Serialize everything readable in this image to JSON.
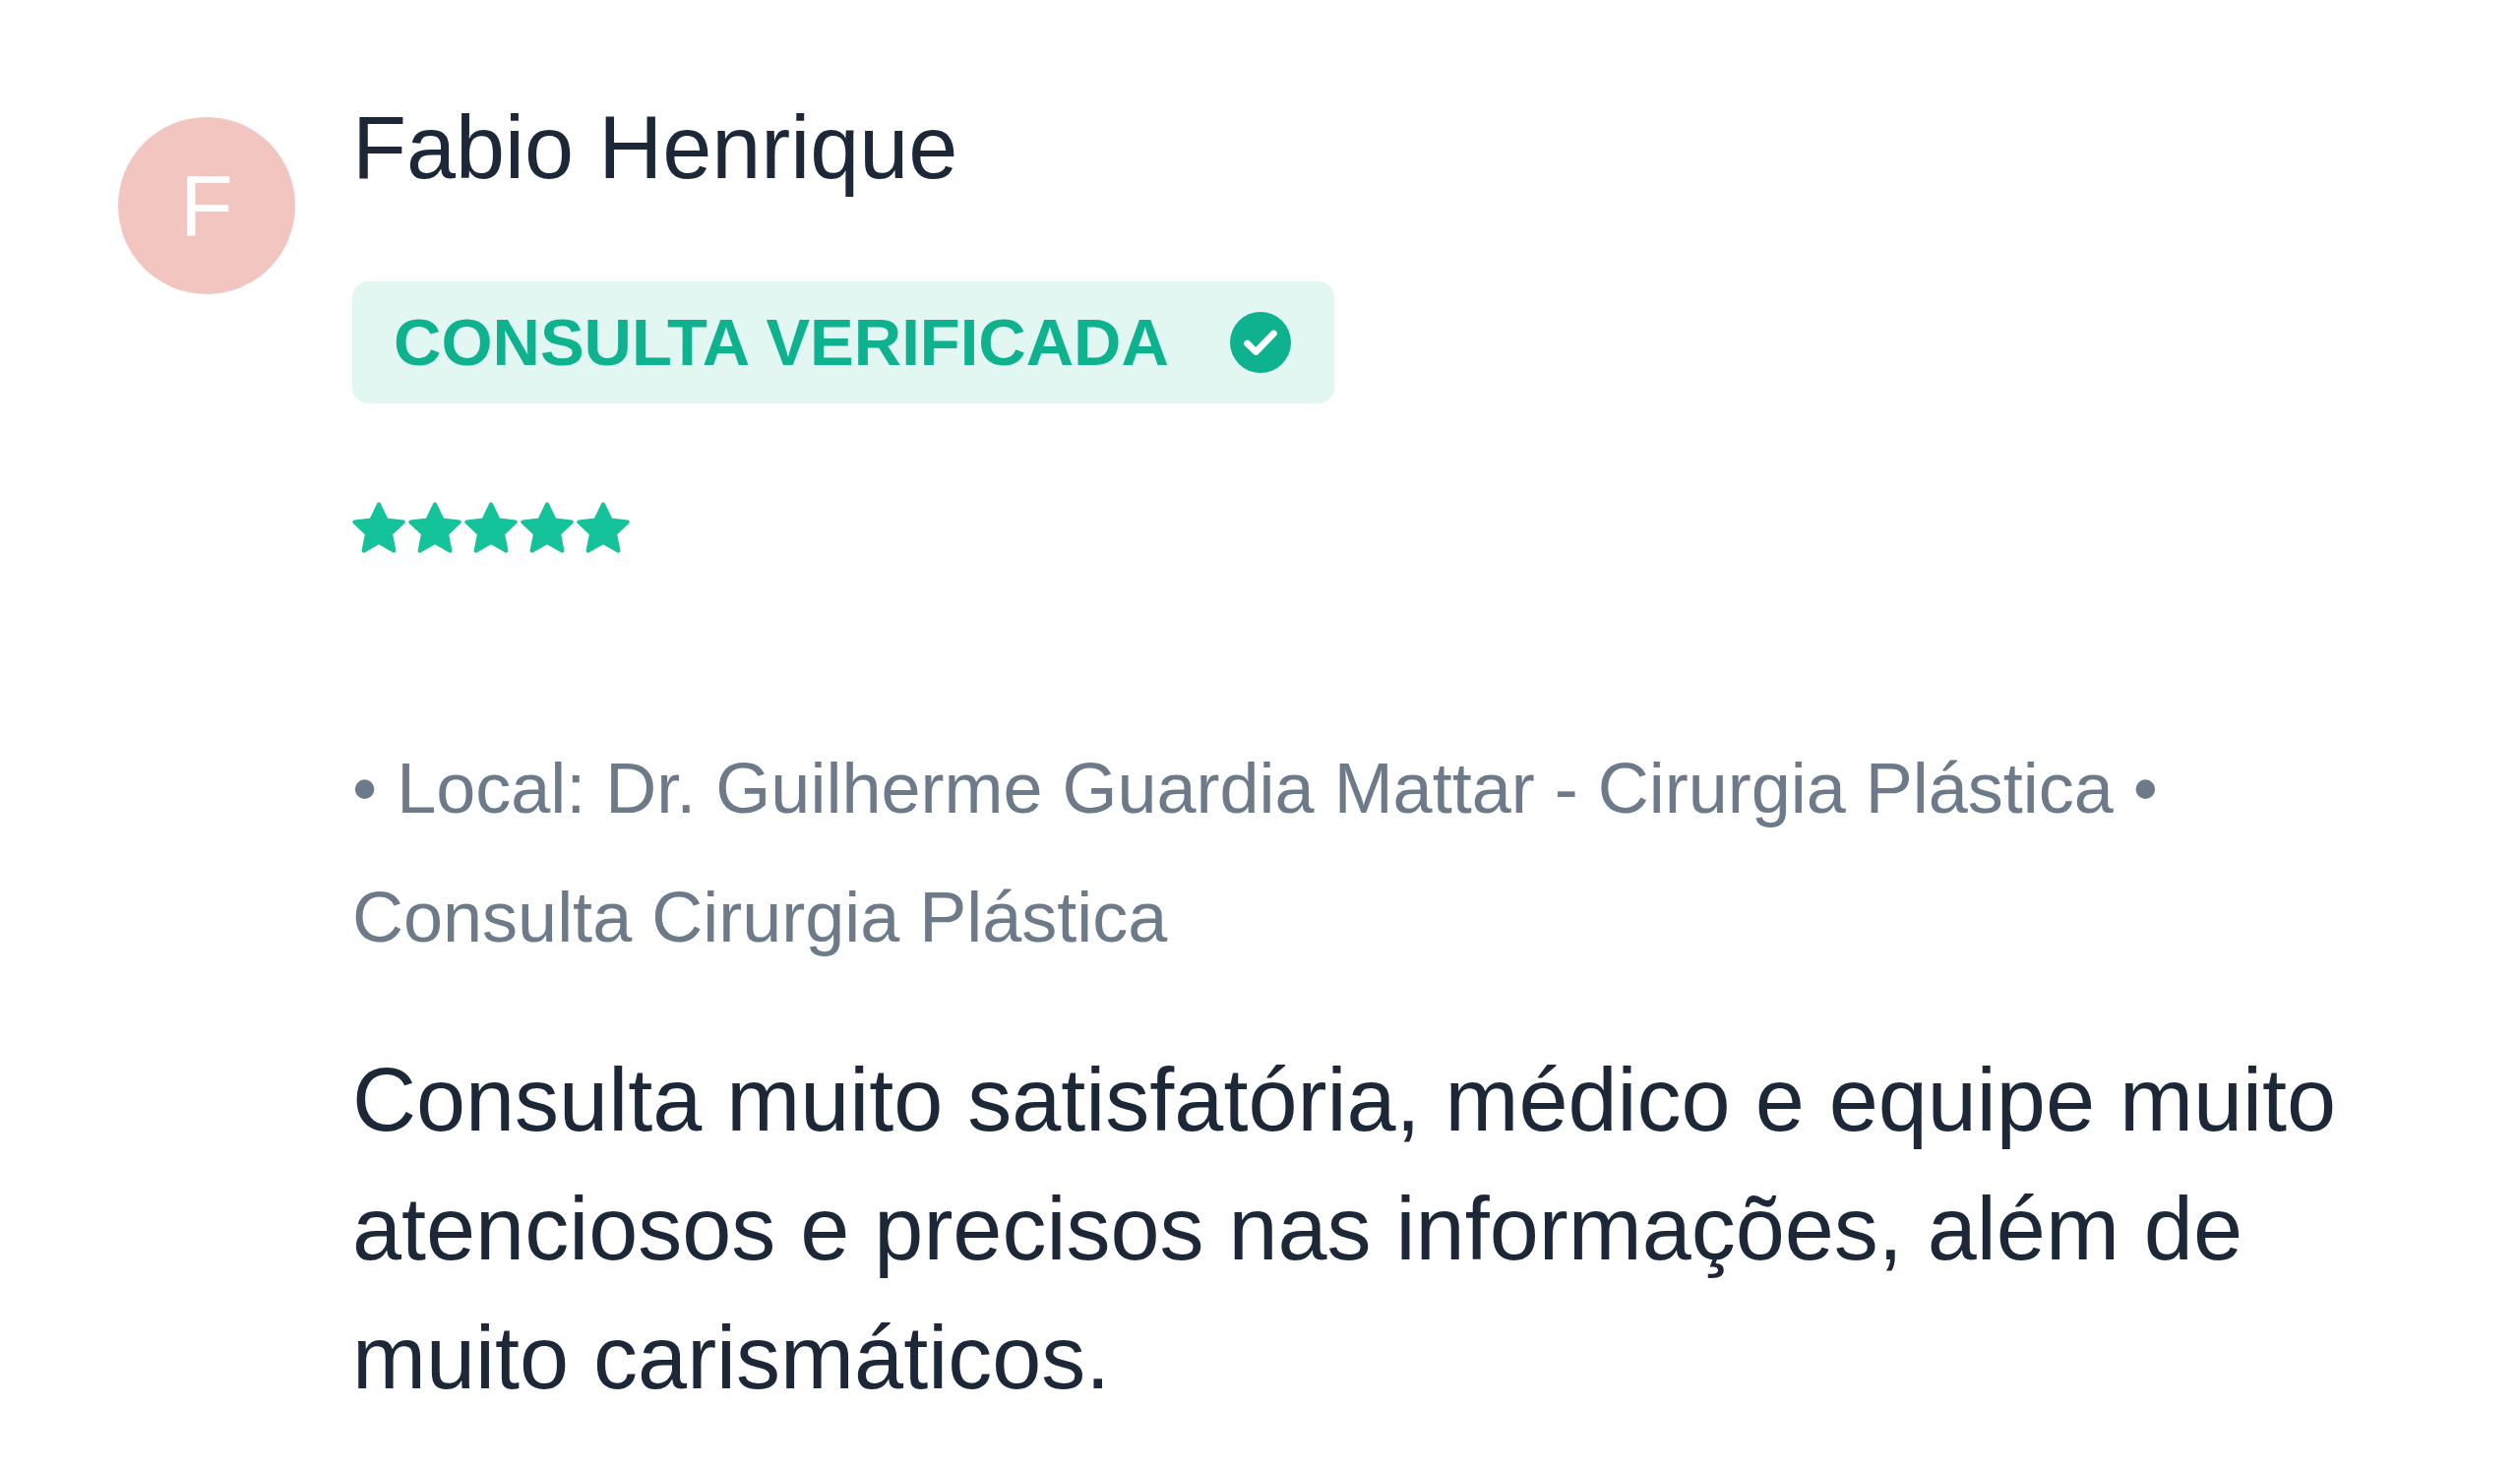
{
  "review": {
    "author": {
      "initial": "F",
      "name": "Fabio Henrique"
    },
    "badge": {
      "label": "CONSULTA VERIFICADA"
    },
    "stars": 5,
    "meta": "• Local: Dr. Guilherme Guardia Mattar - Cirurgia Plástica • Consulta Cirurgia Plástica",
    "text": "Consulta muito satisfatória, médico e equipe muito atenciosos e precisos nas informações, além de muito carismáticos."
  }
}
